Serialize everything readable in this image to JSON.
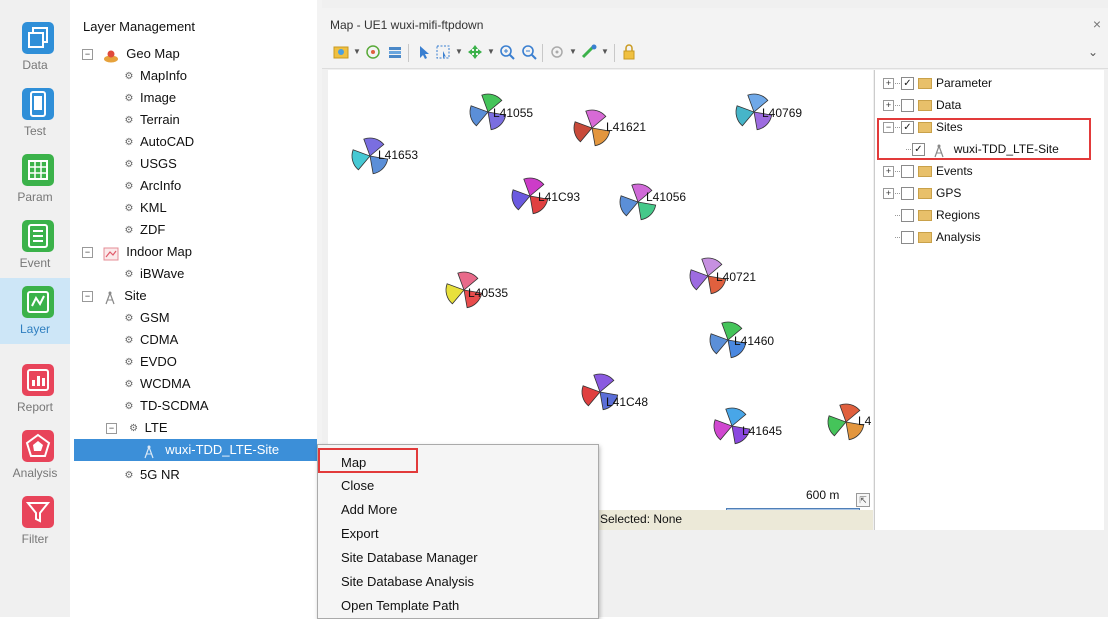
{
  "sidebar": {
    "items": [
      {
        "label": "Data",
        "icon": "windows-icon",
        "active": false
      },
      {
        "label": "Test",
        "icon": "phone-icon",
        "active": false
      },
      {
        "label": "Param",
        "icon": "grid-icon",
        "active": false
      },
      {
        "label": "Event",
        "icon": "list-icon",
        "active": false
      },
      {
        "label": "Layer",
        "icon": "map-icon",
        "active": true
      },
      {
        "label": "Report",
        "icon": "bar-chart-icon",
        "active": false
      },
      {
        "label": "Analysis",
        "icon": "radar-icon",
        "active": false
      },
      {
        "label": "Filter",
        "icon": "funnel-icon",
        "active": false
      }
    ],
    "colors": {
      "blue": "#2f8fd8",
      "green": "#3bb24a",
      "red": "#e8445a"
    }
  },
  "layers": {
    "title": "Layer Management",
    "geo_map": {
      "label": "Geo Map",
      "children": [
        "MapInfo",
        "Image",
        "Terrain",
        "AutoCAD",
        "USGS",
        "ArcInfo",
        "KML",
        "ZDF"
      ]
    },
    "indoor_map": {
      "label": "Indoor Map",
      "children": [
        "iBWave"
      ]
    },
    "site": {
      "label": "Site",
      "children": [
        "GSM",
        "CDMA",
        "EVDO",
        "WCDMA",
        "TD-SCDMA"
      ]
    },
    "lte": {
      "label": "LTE",
      "child": "wuxi-TDD_LTE-Site"
    },
    "nr": {
      "label": "5G NR"
    }
  },
  "map": {
    "title": "Map - UE1 wuxi-mifi-ftpdown",
    "close": "×",
    "toolbar_overflow": "⌄",
    "sites": [
      {
        "label": "L41055",
        "colors": [
          "#45c45a",
          "#7a6ee0",
          "#5b8fd8"
        ]
      },
      {
        "label": "L41621",
        "colors": [
          "#d76ad6",
          "#e3963e",
          "#c84a3a"
        ]
      },
      {
        "label": "L40769",
        "colors": [
          "#6fa8e8",
          "#9d6ce0",
          "#46b5c9"
        ]
      },
      {
        "label": "L41653",
        "colors": [
          "#7a6ee0",
          "#5b8fd8",
          "#46c9d4"
        ]
      },
      {
        "label": "L41C93",
        "colors": [
          "#cc3cc8",
          "#e04040",
          "#6b5ae0"
        ]
      },
      {
        "label": "L41056",
        "colors": [
          "#d06ad8",
          "#46c98a",
          "#5b8fd8"
        ]
      },
      {
        "label": "L40721",
        "colors": [
          "#c690e0",
          "#e0603e",
          "#9d6ce0"
        ]
      },
      {
        "label": "L40535",
        "colors": [
          "#e86a8a",
          "#e84c4c",
          "#e8e03c"
        ]
      },
      {
        "label": "L41460",
        "colors": [
          "#45c45a",
          "#4a88e0",
          "#5b8fd8"
        ]
      },
      {
        "label": "L41C48",
        "colors": [
          "#8a5ae0",
          "#5b6ed8",
          "#e04040"
        ]
      },
      {
        "label": "L41645",
        "colors": [
          "#48a6e8",
          "#8a48e0",
          "#d048d0"
        ]
      },
      {
        "label": "L4",
        "colors": [
          "#e0603e",
          "#e3963e",
          "#45c45a"
        ]
      }
    ],
    "scale_label": "600 m",
    "resize_glyph": "⇱",
    "status": "Selected: None"
  },
  "tree": {
    "items": [
      {
        "label": "Parameter",
        "checked": true
      },
      {
        "label": "Data",
        "checked": false
      },
      {
        "label": "Sites",
        "checked": true
      },
      {
        "label": "wuxi-TDD_LTE-Site",
        "checked": true
      },
      {
        "label": "Events",
        "checked": false
      },
      {
        "label": "GPS",
        "checked": false
      },
      {
        "label": "Regions",
        "checked": false
      },
      {
        "label": "Analysis",
        "checked": false
      }
    ]
  },
  "context_menu": {
    "items": [
      "Map",
      "Close",
      "Add More",
      "Export",
      "Site Database Manager",
      "Site Database Analysis",
      "Open Template Path"
    ]
  },
  "highlight_color": "#e23a3a"
}
